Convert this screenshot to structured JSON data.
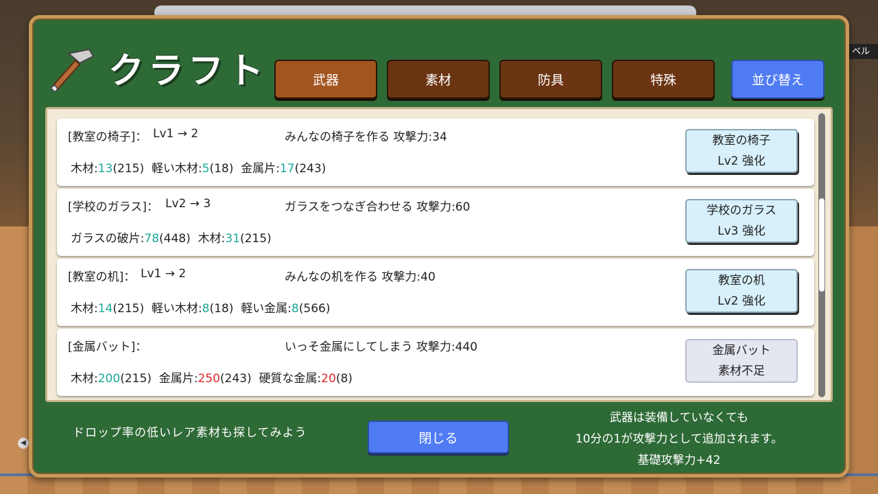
{
  "header": {
    "title": "クラフト",
    "tabs": [
      {
        "label": "武器",
        "active": true
      },
      {
        "label": "素材",
        "active": false
      },
      {
        "label": "防具",
        "active": false
      },
      {
        "label": "特殊",
        "active": false
      }
    ],
    "sort_label": "並び替え"
  },
  "recipes": [
    {
      "name": "[教室の椅子]：",
      "level": "Lv1 → 2",
      "desc": "みんなの椅子を作る 攻撃力:34",
      "mats": [
        {
          "label": "木材:",
          "need": "13",
          "have": "(215)",
          "ok": true
        },
        {
          "label": "軽い木材:",
          "need": "5",
          "have": "(18)",
          "ok": true
        },
        {
          "label": "金属片:",
          "need": "17",
          "have": "(243)",
          "ok": true
        }
      ],
      "btn_line1": "教室の椅子",
      "btn_line2": "Lv2 強化"
    },
    {
      "name": "[学校のガラス]：",
      "level": "Lv2 → 3",
      "desc": "ガラスをつなぎ合わせる 攻撃力:60",
      "mats": [
        {
          "label": "ガラスの破片:",
          "need": "78",
          "have": "(448)",
          "ok": true
        },
        {
          "label": "木材:",
          "need": "31",
          "have": "(215)",
          "ok": true
        }
      ],
      "btn_line1": "学校のガラス",
      "btn_line2": "Lv3 強化"
    },
    {
      "name": "[教室の机]：",
      "level": "Lv1 → 2",
      "desc": "みんなの机を作る 攻撃力:40",
      "mats": [
        {
          "label": "木材:",
          "need": "14",
          "have": "(215)",
          "ok": true
        },
        {
          "label": "軽い木材:",
          "need": "8",
          "have": "(18)",
          "ok": true
        },
        {
          "label": "軽い金属:",
          "need": "8",
          "have": "(566)",
          "ok": true
        }
      ],
      "btn_line1": "教室の机",
      "btn_line2": "Lv2 強化"
    },
    {
      "name": "[金属バット]：",
      "level": "",
      "desc": "いっそ金属にしてしまう 攻撃力:440",
      "mats": [
        {
          "label": "木材:",
          "need": "200",
          "have": "(215)",
          "ok": true
        },
        {
          "label": "金属片:",
          "need": "250",
          "have": "(243)",
          "ok": false
        },
        {
          "label": "硬質な金属:",
          "need": "20",
          "have": "(8)",
          "ok": false
        }
      ],
      "btn_line1": "金属バット",
      "btn_line2": "素材不足"
    }
  ],
  "footer": {
    "hint": "ドロップ率の低いレア素材も探してみよう",
    "close_label": "閉じる",
    "note_line1": "武器は装備していなくても",
    "note_line2": "10分の1が攻撃力として追加されます。",
    "note_line3": "基礎攻撃力+42"
  },
  "background": {
    "right_label": "ベル",
    "left_button": "◀"
  },
  "colors": {
    "panel": "#2e6a36",
    "tab_active": "#a35520",
    "tab_inactive": "#6b3412",
    "accent_blue": "#4f7bf3",
    "ok_number": "#1ba89a",
    "ng_number": "#e0282c"
  }
}
